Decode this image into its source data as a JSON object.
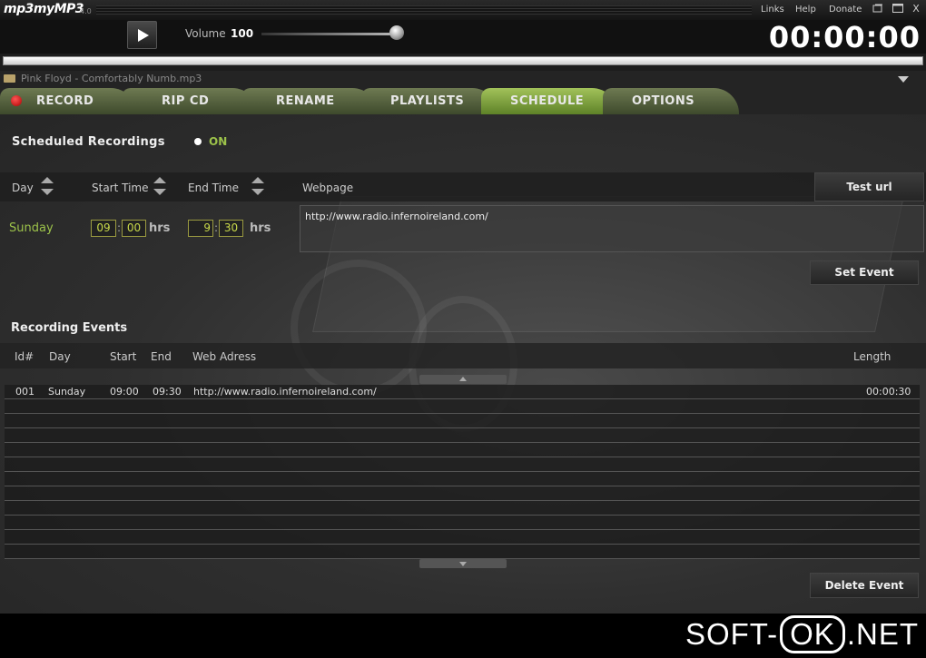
{
  "app": {
    "logo": "mp3myMP3",
    "version": "4.0"
  },
  "menu": {
    "links": "Links",
    "help": "Help",
    "donate": "Donate",
    "close": "X"
  },
  "player": {
    "volume_label": "Volume",
    "volume_value": "100",
    "volume_level": 1.0,
    "timer": "00:00:00",
    "progress": 1.0
  },
  "file": {
    "name": "Pink Floyd - Comfortably Numb.mp3"
  },
  "tabs": [
    {
      "label": "RECORD"
    },
    {
      "label": "RIP CD"
    },
    {
      "label": "RENAME"
    },
    {
      "label": "PLAYLISTS"
    },
    {
      "label": "SCHEDULE",
      "active": true
    },
    {
      "label": "OPTIONS"
    }
  ],
  "schedule": {
    "title": "Scheduled Recordings",
    "status": "ON",
    "headers": {
      "day": "Day",
      "start_time": "Start Time",
      "end_time": "End Time",
      "webpage": "Webpage"
    },
    "test_url_button": "Test url",
    "day": "Sunday",
    "start_hour": "09",
    "start_min": "00",
    "end_hour": "9",
    "end_min": "30",
    "hrs_label": "hrs",
    "time_sep": ":",
    "webpage": "http://www.radio.infernoireland.com/",
    "set_event_button": "Set Event"
  },
  "events": {
    "title": "Recording Events",
    "columns": {
      "id": "Id#",
      "day": "Day",
      "start": "Start",
      "end": "End",
      "web": "Web Adress",
      "length": "Length"
    },
    "rows": [
      {
        "id": "001",
        "day": "Sunday",
        "start": "09:00",
        "end": "09:30",
        "web": "http://www.radio.infernoireland.com/",
        "length": "00:00:30"
      }
    ],
    "delete_button": "Delete Event"
  },
  "watermark": {
    "left": "SOFT-",
    "mid": "OK",
    "right": ".NET"
  },
  "colors": {
    "accent_green": "#9cc24a",
    "tab_active": "#8fb24a",
    "background": "#2f2f2f"
  }
}
